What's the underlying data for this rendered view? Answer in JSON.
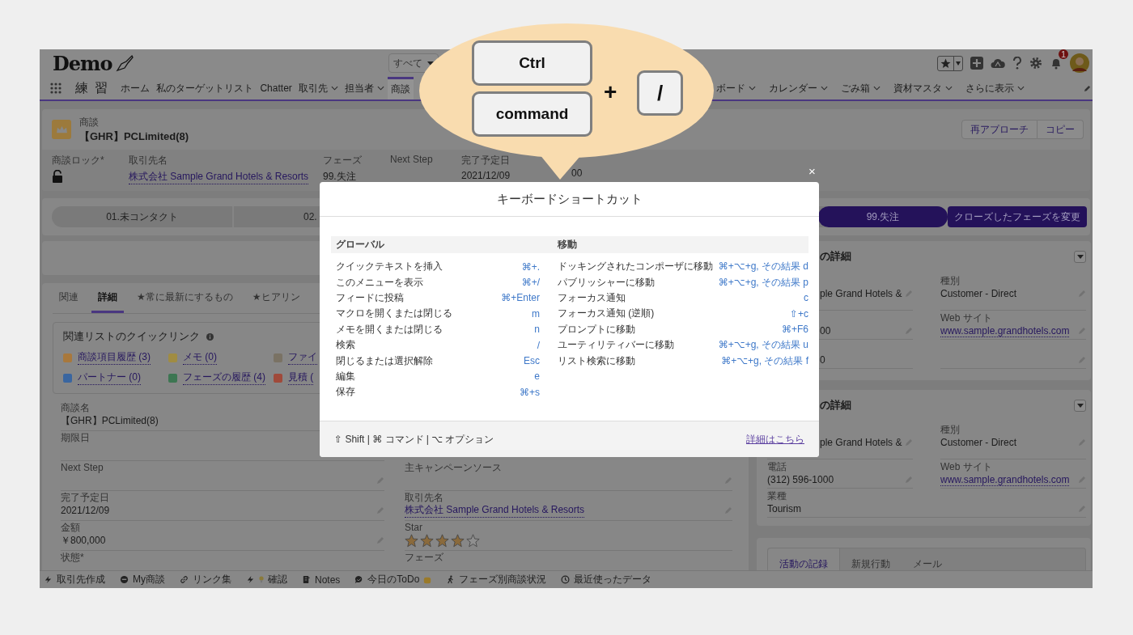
{
  "header": {
    "logo": "Demo",
    "search_scope": "すべて",
    "notification_count": "1"
  },
  "nav": {
    "app_name": "練 習",
    "items": [
      {
        "label": "ホーム",
        "dropdown": false,
        "selected": false
      },
      {
        "label": "私のターゲットリスト",
        "dropdown": false,
        "selected": false
      },
      {
        "label": "Chatter",
        "dropdown": false,
        "selected": false
      },
      {
        "label": "取引先",
        "dropdown": true,
        "selected": false
      },
      {
        "label": "担当者",
        "dropdown": true,
        "selected": false
      },
      {
        "label": "商談",
        "dropdown": false,
        "selected": true
      }
    ],
    "more_items": [
      {
        "label": "ボード",
        "dropdown": true,
        "selected": false
      },
      {
        "label": "カレンダー",
        "dropdown": true,
        "selected": false
      },
      {
        "label": "ごみ箱",
        "dropdown": true,
        "selected": false
      },
      {
        "label": "資材マスタ",
        "dropdown": true,
        "selected": false
      },
      {
        "label": "さらに表示",
        "dropdown": true,
        "selected": false
      }
    ]
  },
  "record": {
    "object_label": "商談",
    "title": "【GHR】PCLimited(8)",
    "buttons": [
      "再アプローチ",
      "コピー"
    ],
    "highlights": [
      {
        "kind": "lock",
        "label": "商談ロック*"
      },
      {
        "kind": "link",
        "label": "取引先名",
        "value": "株式会社 Sample Grand Hotels & Resorts"
      },
      {
        "kind": "text",
        "label": "フェーズ",
        "value": "99.失注"
      },
      {
        "kind": "text",
        "label": "Next Step"
      },
      {
        "kind": "text",
        "label": "完了予定日",
        "value": "2021/12/09"
      },
      {
        "kind": "text",
        "value": "00"
      }
    ]
  },
  "path": {
    "stages": [
      {
        "label": "01.未コンタクト",
        "selected": false
      },
      {
        "label": "02.",
        "selected": false
      },
      {
        "label": "99.失注",
        "selected": true
      }
    ],
    "button": "クローズしたフェーズを変更"
  },
  "detail_tabs": [
    {
      "label": "関連",
      "selected": false
    },
    {
      "label": "詳細",
      "selected": true
    },
    {
      "label": "★常に最新にするもの",
      "selected": false
    },
    {
      "label": "★ヒアリン",
      "selected": false
    }
  ],
  "quick_links": {
    "title": "関連リストのクイックリンク",
    "links": [
      {
        "label": "商談項目履歴 (3)",
        "color": "#a8783c"
      },
      {
        "label": "メモ (0)",
        "color": "#a08c42"
      },
      {
        "label": "ファイ",
        "color": "#7a7264"
      },
      {
        "label": "パートナー (0)",
        "color": "#3a66a0"
      },
      {
        "label": "フェーズの履歴 (4)",
        "color": "#3d7652"
      },
      {
        "label": "見積 (",
        "color": "#a04a3a"
      }
    ]
  },
  "fields_left": [
    {
      "label": "商談名",
      "value": "【GHR】PCLimited(8)",
      "editable": false
    },
    {
      "label": "期限日",
      "editable": false
    },
    {
      "label": "Next Step",
      "editable": true
    },
    {
      "label": "完了予定日",
      "value": "2021/12/09",
      "editable": true
    },
    {
      "label": "金額",
      "value": "￥800,000",
      "editable": true
    },
    {
      "label": "状態*",
      "editable": false
    }
  ],
  "fields_right": [
    {
      "label": "主キャンペーンソース",
      "kind": "text",
      "editable": true
    },
    {
      "label": "取引先名",
      "kind": "link",
      "value": "株式会社 Sample Grand Hotels & Resorts",
      "editable": true
    },
    {
      "label": "Star",
      "kind": "stars",
      "stars": 4
    },
    {
      "label": "フェーズ",
      "kind": "text",
      "editable": false
    }
  ],
  "side_cards": [
    {
      "title": "の詳細",
      "fields": [
        {
          "kind": "text",
          "value": "ple Grand Hotels &",
          "editable": true
        },
        {
          "kind": "text",
          "label": "種別",
          "value": "Customer - Direct",
          "editable": true
        },
        {
          "kind": "text",
          "value": "00",
          "editable": true
        },
        {
          "kind": "link",
          "label": "Web サイト",
          "value": "www.sample.grandhotels.com",
          "editable": true
        },
        {
          "kind": "text",
          "value": "0",
          "editable": false
        },
        {
          "kind": "text",
          "editable": true
        }
      ]
    },
    {
      "title": "の詳細",
      "fields": [
        {
          "kind": "text",
          "value": "ple Grand Hotels &",
          "editable": true
        },
        {
          "kind": "text",
          "label": "種別",
          "value": "Customer - Direct",
          "editable": true
        },
        {
          "kind": "text",
          "label": "電話",
          "value": "(312) 596-1000",
          "editable": true
        },
        {
          "kind": "link",
          "label": "Web サイト",
          "value": "www.sample.grandhotels.com",
          "editable": true
        },
        {
          "kind": "text",
          "label": "業種",
          "value": "Tourism",
          "editable": true
        }
      ]
    }
  ],
  "activity_tabs": [
    {
      "label": "活動の記録",
      "selected": true
    },
    {
      "label": "新規行動",
      "selected": false
    },
    {
      "label": "メール",
      "selected": false
    }
  ],
  "utility_bar": [
    "取引先作成",
    "My商談",
    "リンク集",
    "確認",
    "Notes",
    "今日のToDo",
    "フェーズ別商談状況",
    "最近使ったデータ"
  ],
  "modal": {
    "close": "×",
    "title": "キーボードショートカット",
    "sections": [
      {
        "heading": "グローバル",
        "shortcuts": [
          {
            "action": "クイックテキストを挿入",
            "keys": "⌘+."
          },
          {
            "action": "このメニューを表示",
            "keys": "⌘+/"
          },
          {
            "action": "フィードに投稿",
            "keys": "⌘+Enter"
          },
          {
            "action": "マクロを開くまたは閉じる",
            "keys": "m"
          },
          {
            "action": "メモを開くまたは閉じる",
            "keys": "n"
          },
          {
            "action": "検索",
            "keys": "/"
          },
          {
            "action": "閉じるまたは選択解除",
            "keys": "Esc"
          },
          {
            "action": "編集",
            "keys": "e"
          },
          {
            "action": "保存",
            "keys": "⌘+s"
          }
        ]
      },
      {
        "heading": "移動",
        "shortcuts": [
          {
            "action": "ドッキングされたコンポーザに移動",
            "keys": "⌘+⌥+g, その結果 d"
          },
          {
            "action": "パブリッシャーに移動",
            "keys": "⌘+⌥+g, その結果 p"
          },
          {
            "action": "フォーカス通知",
            "keys": "c"
          },
          {
            "action": "フォーカス通知 (逆順)",
            "keys": "⇧+c"
          },
          {
            "action": "プロンプトに移動",
            "keys": "⌘+F6"
          },
          {
            "action": "ユーティリティバーに移動",
            "keys": "⌘+⌥+g, その結果 u"
          },
          {
            "action": "リスト検索に移動",
            "keys": "⌘+⌥+g, その結果 f"
          }
        ]
      }
    ],
    "legend": "⇧ Shift | ⌘ コマンド | ⌥ オプション",
    "more_link": "詳細はこちら"
  },
  "callout": {
    "modifier_keys": [
      "Ctrl",
      "command"
    ],
    "plus": "+",
    "key": "/"
  }
}
